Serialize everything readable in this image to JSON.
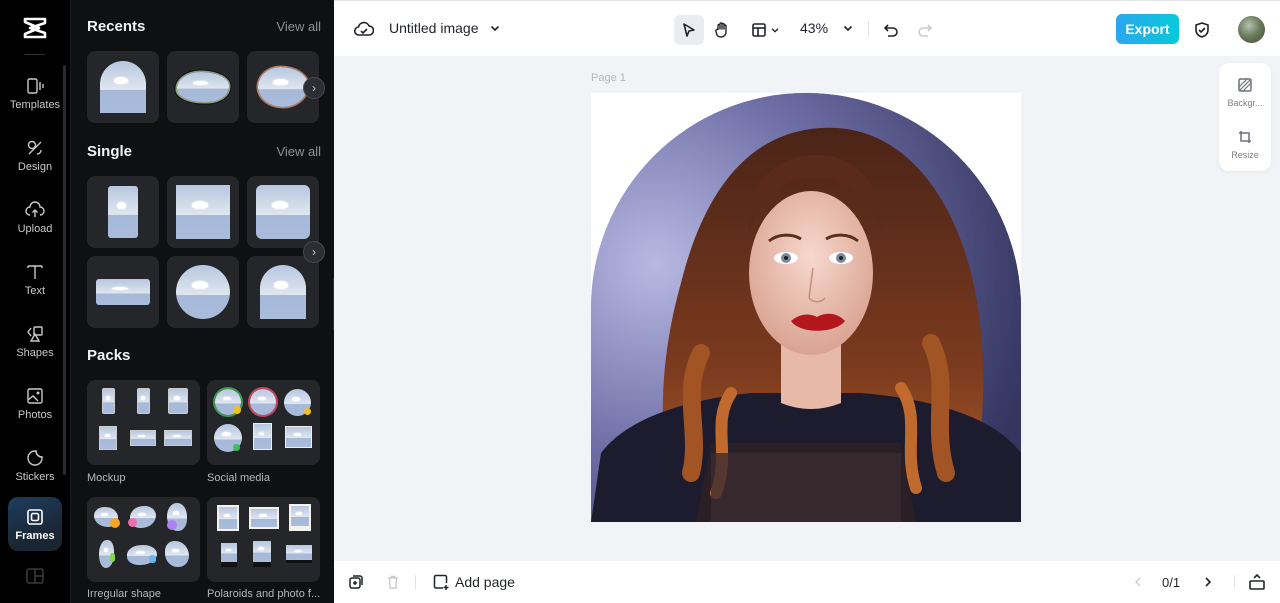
{
  "rail": {
    "logo": "capcut-logo",
    "items": [
      {
        "label": "Templates",
        "icon": "templates-icon"
      },
      {
        "label": "Design",
        "icon": "design-icon"
      },
      {
        "label": "Upload",
        "icon": "upload-icon"
      },
      {
        "label": "Text",
        "icon": "text-icon"
      },
      {
        "label": "Shapes",
        "icon": "shapes-icon"
      },
      {
        "label": "Photos",
        "icon": "photos-icon"
      },
      {
        "label": "Stickers",
        "icon": "stickers-icon"
      },
      {
        "label": "Frames",
        "icon": "frames-icon",
        "active": true
      }
    ]
  },
  "panel": {
    "recents": {
      "title": "Recents",
      "view_all": "View all"
    },
    "single": {
      "title": "Single",
      "view_all": "View all"
    },
    "packs": {
      "title": "Packs",
      "items": [
        {
          "label": "Mockup"
        },
        {
          "label": "Social media"
        },
        {
          "label": "Irregular shape"
        },
        {
          "label": "Polaroids and photo f..."
        }
      ]
    }
  },
  "topbar": {
    "doc_title": "Untitled image",
    "zoom": "43%",
    "export_label": "Export"
  },
  "canvas": {
    "page_label": "Page 1"
  },
  "side_tools": [
    {
      "label": "Backgr...",
      "icon": "background-icon"
    },
    {
      "label": "Resize",
      "icon": "resize-icon"
    }
  ],
  "bottombar": {
    "add_page": "Add page",
    "page_counter": "0/1"
  },
  "colors": {
    "accent_start": "#2aa7f0",
    "accent_end": "#08c9d8",
    "rail_bg": "#000000",
    "panel_bg": "#0f1012",
    "canvas_bg": "#f1f3f6"
  }
}
